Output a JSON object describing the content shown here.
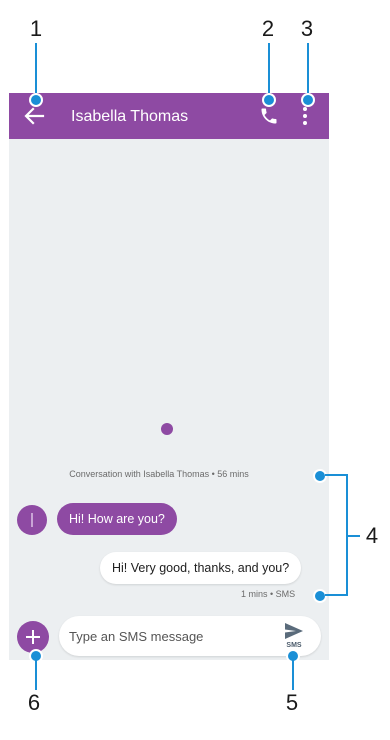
{
  "callouts": [
    "1",
    "2",
    "3",
    "4",
    "5",
    "6"
  ],
  "header": {
    "contact_name": "Isabella Thomas"
  },
  "conversation": {
    "info": "Conversation with Isabella Thomas • 56 mins",
    "messages": [
      {
        "direction": "incoming",
        "text": "Hi! How are you?"
      },
      {
        "direction": "outgoing",
        "text": "Hi! Very good, thanks, and you?",
        "meta": "1 mins • SMS"
      }
    ]
  },
  "composer": {
    "placeholder": "Type an SMS message",
    "send_sublabel": "SMS"
  },
  "colors": {
    "accent": "#8e4aa3",
    "callout": "#1a8fd6",
    "background": "#eceff1"
  },
  "icons": [
    "back-arrow-icon",
    "phone-icon",
    "more-vert-icon",
    "plus-icon",
    "send-icon"
  ]
}
